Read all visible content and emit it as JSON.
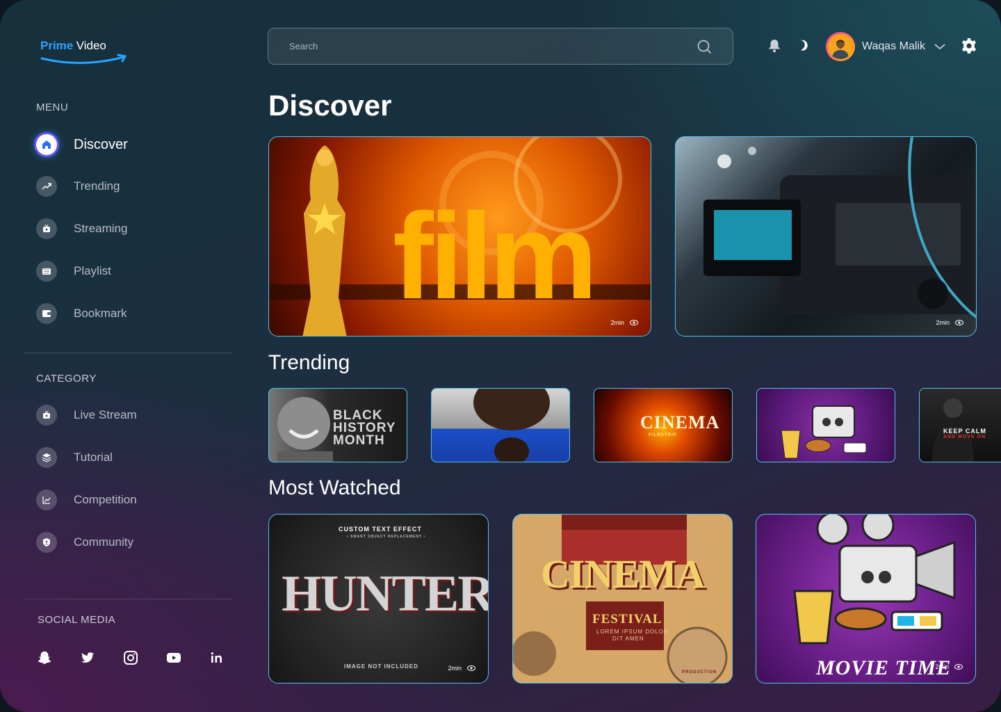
{
  "brand": {
    "prime": "Prime",
    "video": "Video"
  },
  "sidebar": {
    "menu_title": "MENU",
    "menu": [
      {
        "label": "Discover",
        "icon": "home-icon"
      },
      {
        "label": "Trending",
        "icon": "trending-icon"
      },
      {
        "label": "Streaming",
        "icon": "streaming-icon"
      },
      {
        "label": "Playlist",
        "icon": "playlist-icon"
      },
      {
        "label": "Bookmark",
        "icon": "bookmark-icon"
      }
    ],
    "category_title": "CATEGORY",
    "categories": [
      {
        "label": "Live Stream",
        "icon": "live-stream-icon"
      },
      {
        "label": "Tutorial",
        "icon": "tutorial-icon"
      },
      {
        "label": "Competition",
        "icon": "competition-icon"
      },
      {
        "label": "Community",
        "icon": "community-icon"
      }
    ],
    "social_title": "SOCIAL MEDIA",
    "social": [
      "snapchat-icon",
      "twitter-icon",
      "instagram-icon",
      "youtube-icon",
      "linkedin-icon"
    ]
  },
  "header": {
    "search_placeholder": "Search",
    "user_name": "Waqas Malik"
  },
  "main": {
    "title": "Discover",
    "hero": [
      {
        "text": "film",
        "duration": "2min"
      },
      {
        "duration": "2min"
      }
    ],
    "trending_title": "Trending",
    "trending": [
      {
        "text": "BLACK HISTORY MONTH"
      },
      {},
      {
        "text": "CINEMA",
        "sub": "FILMSTRIP"
      },
      {},
      {
        "text": "KEEP CALM",
        "sub": "AND MOVE ON"
      }
    ],
    "most_watched_title": "Most Watched",
    "most_watched": [
      {
        "top": "CUSTOM TEXT EFFECT",
        "top_sub": "• SMART OBJECT REPLACEMENT •",
        "text": "HUNTERS",
        "bottom": "IMAGE NOT INCLUDED",
        "duration": "2min"
      },
      {
        "text": "CINEMA",
        "sub": "FESTIVAL",
        "sub2": "LOREM IPSUM DOLOR",
        "sub3": "DIT AMEN",
        "badge": "PRODUCTION"
      },
      {
        "text": "MOVIE TIME",
        "duration": "2min"
      }
    ]
  },
  "colors": {
    "accent": "#2aa3ff",
    "card_border": "#4fc3e8",
    "brand_blue": "#2aa3ff"
  }
}
